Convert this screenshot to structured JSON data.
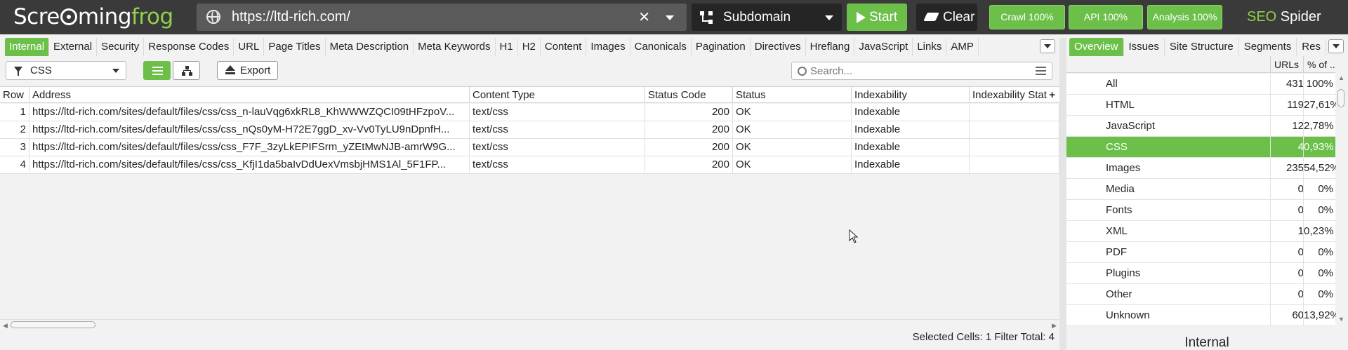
{
  "app": {
    "logo_pre": "Scre",
    "logo_post": "ming",
    "logo_frog": "frog",
    "brand_seo": "SEO",
    "brand_spider": " Spider"
  },
  "header": {
    "url": "https://ltd-rich.com/",
    "mode": "Subdomain",
    "start_label": "Start",
    "clear_label": "Clear",
    "crawl_label": "Crawl 100%",
    "api_label": "API 100%",
    "analysis_label": "Analysis 100%"
  },
  "tabs": [
    {
      "label": "Internal",
      "active": true
    },
    {
      "label": "External"
    },
    {
      "label": "Security"
    },
    {
      "label": "Response Codes"
    },
    {
      "label": "URL"
    },
    {
      "label": "Page Titles"
    },
    {
      "label": "Meta Description"
    },
    {
      "label": "Meta Keywords"
    },
    {
      "label": "H1"
    },
    {
      "label": "H2"
    },
    {
      "label": "Content"
    },
    {
      "label": "Images"
    },
    {
      "label": "Canonicals"
    },
    {
      "label": "Pagination"
    },
    {
      "label": "Directives"
    },
    {
      "label": "Hreflang"
    },
    {
      "label": "JavaScript"
    },
    {
      "label": "Links"
    },
    {
      "label": "AMP"
    }
  ],
  "toolbar": {
    "filter_value": "CSS",
    "export_label": "Export",
    "search_placeholder": "Search..."
  },
  "grid": {
    "columns": [
      "Row",
      "Address",
      "Content Type",
      "Status Code",
      "Status",
      "Indexability",
      "Indexability Stat"
    ],
    "rows": [
      {
        "row": "1",
        "address": "https://ltd-rich.com/sites/default/files/css/css_n-lauVqg6xkRL8_KhWWWZQCI09tHFzpoV...",
        "content_type": "text/css",
        "status_code": "200",
        "status": "OK",
        "indexability": "Indexable",
        "indexability_status": ""
      },
      {
        "row": "2",
        "address": "https://ltd-rich.com/sites/default/files/css/css_nQs0yM-H72E7ggD_xv-Vv0TyLU9nDpnfH...",
        "content_type": "text/css",
        "status_code": "200",
        "status": "OK",
        "indexability": "Indexable",
        "indexability_status": ""
      },
      {
        "row": "3",
        "address": "https://ltd-rich.com/sites/default/files/css/css_F7F_3zyLkEPIFSrm_yZEtMwNJB-amrW9G...",
        "content_type": "text/css",
        "status_code": "200",
        "status": "OK",
        "indexability": "Indexable",
        "indexability_status": ""
      },
      {
        "row": "4",
        "address": "https://ltd-rich.com/sites/default/files/css/css_KfjI1da5baIvDdUexVmsbjHMS1Al_5F1FP...",
        "content_type": "text/css",
        "status_code": "200",
        "status": "OK",
        "indexability": "Indexable",
        "indexability_status": ""
      }
    ]
  },
  "statusbar": {
    "text": "Selected Cells:  1  Filter Total:  4"
  },
  "right_tabs": [
    {
      "label": "Overview",
      "active": true
    },
    {
      "label": "Issues"
    },
    {
      "label": "Site Structure"
    },
    {
      "label": "Segments"
    },
    {
      "label": "Res"
    }
  ],
  "overview": {
    "col_urls": "URLs",
    "col_pct": "% of ...",
    "rows": [
      {
        "name": "All",
        "count": "431",
        "pct": "100%"
      },
      {
        "name": "HTML",
        "count": "119",
        "pct": "27,61%"
      },
      {
        "name": "JavaScript",
        "count": "12",
        "pct": "2,78%"
      },
      {
        "name": "CSS",
        "count": "4",
        "pct": "0,93%",
        "selected": true
      },
      {
        "name": "Images",
        "count": "235",
        "pct": "54,52%"
      },
      {
        "name": "Media",
        "count": "0",
        "pct": "0%"
      },
      {
        "name": "Fonts",
        "count": "0",
        "pct": "0%"
      },
      {
        "name": "XML",
        "count": "1",
        "pct": "0,23%"
      },
      {
        "name": "PDF",
        "count": "0",
        "pct": "0%"
      },
      {
        "name": "Plugins",
        "count": "0",
        "pct": "0%"
      },
      {
        "name": "Other",
        "count": "0",
        "pct": "0%"
      },
      {
        "name": "Unknown",
        "count": "60",
        "pct": "13,92%"
      }
    ],
    "chart_title": "Internal"
  },
  "colors": {
    "accent": "#6cc04a",
    "header_bg": "#3a3a3a"
  }
}
